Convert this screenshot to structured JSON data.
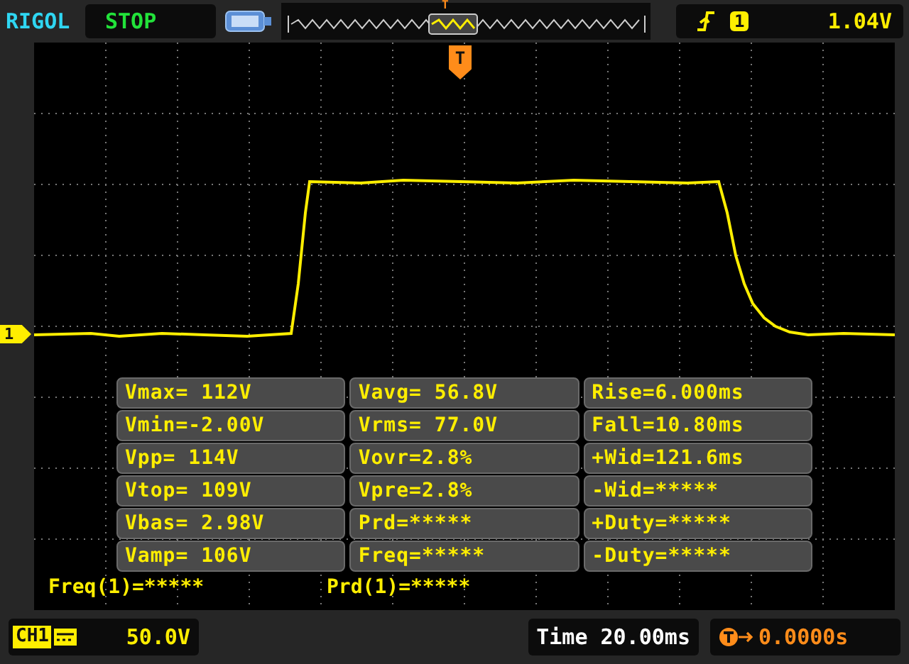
{
  "header": {
    "brand": "RIGOL",
    "run_state": "STOP",
    "memory_trigger": "T",
    "trigger": {
      "source": "1",
      "level": "1.04V"
    }
  },
  "markers": {
    "trigger": "T",
    "channel": "1"
  },
  "measurements": [
    [
      "Vmax= 112V",
      "Vavg= 56.8V",
      "Rise=6.000ms"
    ],
    [
      "Vmin=-2.00V",
      "Vrms= 77.0V",
      "Fall=10.80ms"
    ],
    [
      "Vpp= 114V",
      "Vovr=2.8%",
      "+Wid=121.6ms"
    ],
    [
      "Vtop= 109V",
      "Vpre=2.8%",
      "-Wid=*****"
    ],
    [
      "Vbas= 2.98V",
      "Prd=*****",
      "+Duty=*****"
    ],
    [
      "Vamp= 106V",
      "Freq=*****",
      "-Duty=*****"
    ]
  ],
  "counters": [
    "Freq(1)=*****",
    "Prd(1)=*****"
  ],
  "footer": {
    "channel": "CH1",
    "scale": "50.0V",
    "timebase": "Time 20.00ms",
    "trigger_offset": "0.0000s"
  }
}
